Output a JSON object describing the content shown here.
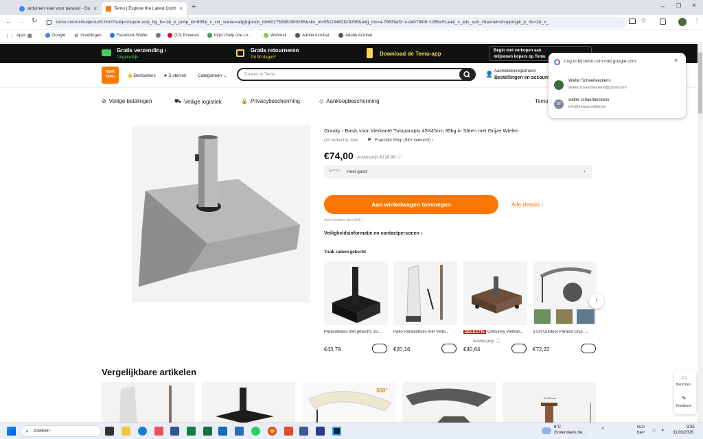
{
  "browser": {
    "tabs": [
      {
        "title": "arduinen voet voor parasol - Go",
        "active": false
      },
      {
        "title": "Temu | Explore the Latest Cloth",
        "active": true
      }
    ],
    "url": "temu.com/ul/kuiper/un9.html?subj=coupon-un&_bg_fs=1&_p_jump_id=895&_x_vst_scene=adg&goods_id=601750982900265&sku_id=55119462829265&adg_ctx=a-79639af2~c-d407f808~f-95bc51aa&_x_ads_sub_channel=shopping&_p_rfs=1&_x_",
    "bookmarks": [
      "Apps",
      "Google",
      "Instellingen",
      "Facebook Walter",
      "(10) Pinterest",
      "https://help.one.co...",
      "Webmail",
      "Adobe Acrobat",
      "Adobe Acrobat"
    ]
  },
  "promo": {
    "free_shipping": "Gratis verzending",
    "free_shipping_sub": "Ongelooflijk",
    "free_returns": "Gratis retourneren",
    "free_returns_sub": "Tot 90 dagen*",
    "download": "Download de Temu-app",
    "sell_line1": "Begin met verkopen aan",
    "sell_line2": "miljoenen kopers op Temu"
  },
  "header": {
    "logo_top": "TE|MU",
    "logo_bottom": "TEMU",
    "bestsellers": "Bestsellers",
    "five_stars": "5-sterren",
    "categories": "Categorieën",
    "search_placeholder": "Zoeken in Temu",
    "account_line1": "Aanmelden/registreren",
    "account_line2": "Bestellingen en account"
  },
  "trust": [
    "Veilige betalingen",
    "Veilige logistiek",
    "Privacybescherming",
    "Aankoopbescherming",
    "Temu"
  ],
  "product": {
    "title": "Gravity - Basis voor Vierkante Tuinparaplu 45X45cm 35kg in Steen met Grijze Wielen",
    "sold": "(20 verkocht), door",
    "shop": "Franchini Shop (9K+ verkocht)",
    "price": "€74,00",
    "advice": "Adviesprijs €118,99",
    "review_user": "M***m",
    "review_text": "Heel goed",
    "cart_button": "Aan winkelwagen toevoegen",
    "all_details": "Alle details",
    "ads_note": "Advertenties specifiek",
    "safety": "Veiligheidsinformatie en contactpersonen"
  },
  "frequently_bought": {
    "title": "Vaak samen gekocht",
    "items": [
      {
        "label": "Parasolbasis met gewicht, 16...",
        "price": "€43,79"
      },
      {
        "label": "Patio Parasolhoes met Verbi...",
        "price": "€20,16"
      },
      {
        "badge": "SELECTIE",
        "label": "Outsunny Vierkan...",
        "sub": "Adviesprijs",
        "price": "€40,64"
      },
      {
        "label": "3.5m Outdoor Parasol Grijs, ...",
        "price": "€72,22"
      }
    ]
  },
  "similar": {
    "title": "Vergelijkbare artikelen",
    "badge_360": "360°",
    "measure": "23-30 mm"
  },
  "login_popup": {
    "title": "Log in bij temu.com met google.com",
    "accounts": [
      {
        "name": "Walter Schaerlaeckens",
        "email": "walter.schaerlaeckens@gmail.com",
        "initial": "W"
      },
      {
        "name": "walter schaerlaeckens",
        "email": "info@mowamodels.be",
        "initial": "W"
      }
    ]
  },
  "side_tools": {
    "messages": "Berichten",
    "feedback": "Feedback"
  },
  "taskbar": {
    "search": "Zoeken",
    "weather_temp": "6°C",
    "weather_text": "Grotendeels be...",
    "lang1": "NLD",
    "lang2": "BEP",
    "time": "9:35",
    "date": "31/03/2026"
  },
  "colors": {
    "accent": "#fb7701",
    "dark": "#111111"
  }
}
